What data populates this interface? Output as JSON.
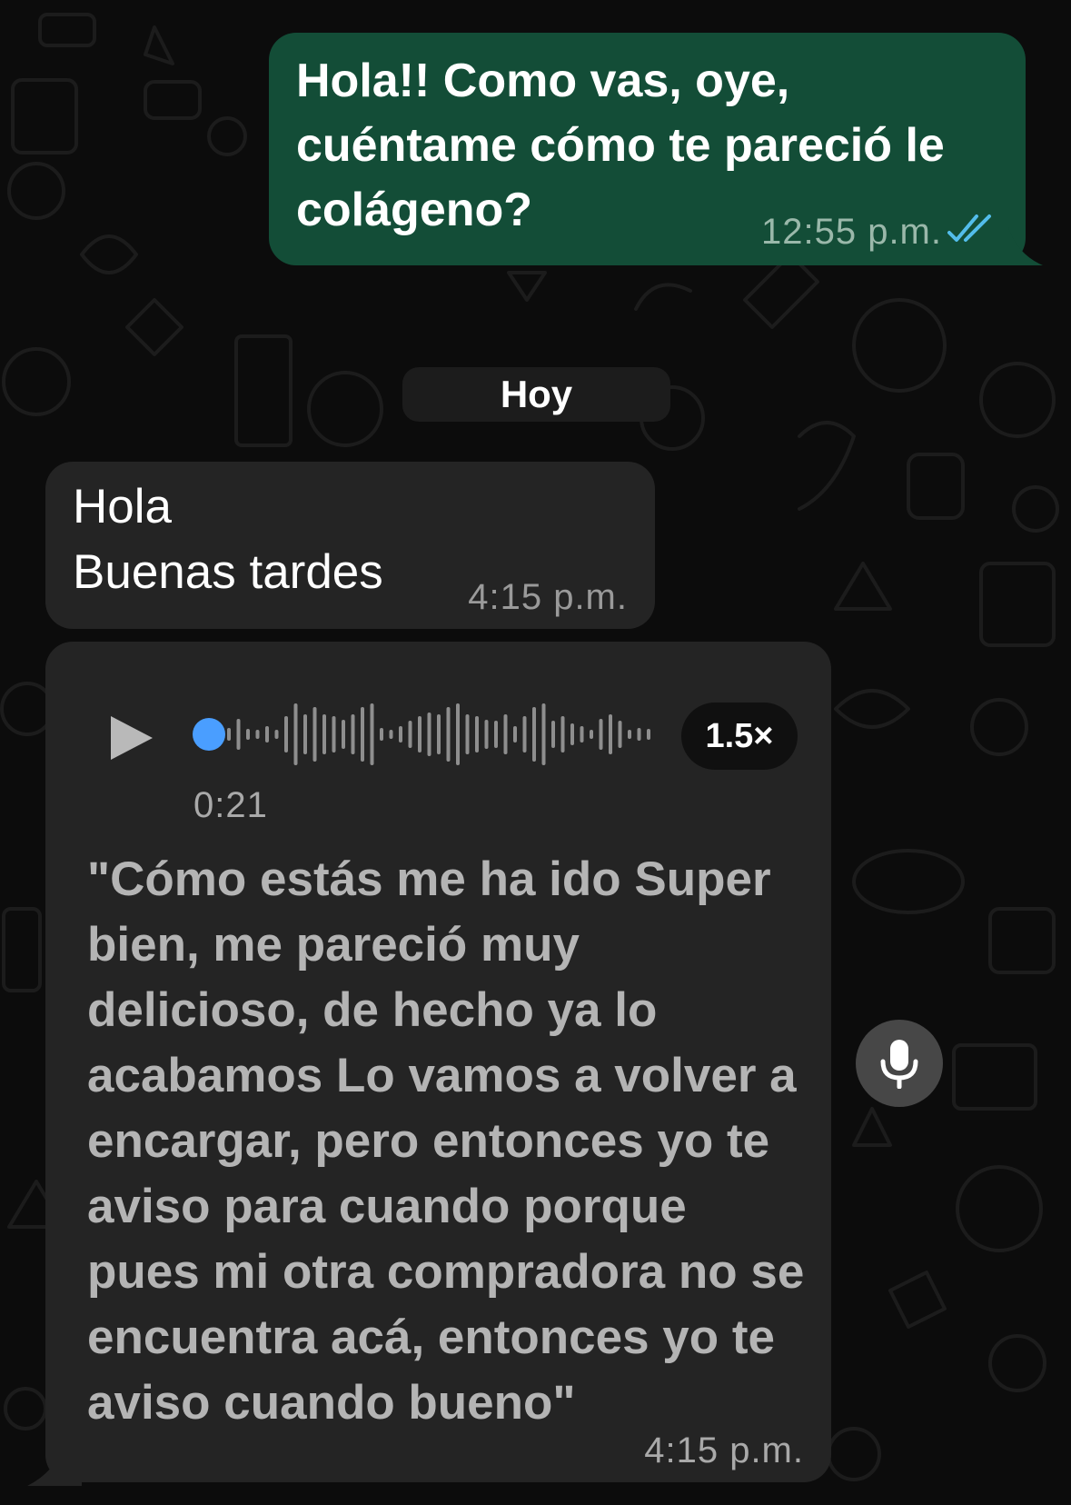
{
  "chat": {
    "outgoing_message": {
      "text": "Hola!! Como vas, oye,\ncuéntame cómo te pareció le\ncolágeno?",
      "time": "12:55 p.m.",
      "status_icon": "double-check-read-icon",
      "bubble_color": "#134d37",
      "tick_color": "#53bdeb"
    },
    "date_separator": "Hoy",
    "incoming_text_message": {
      "text": "Hola\nBuenas tardes",
      "time": "4:15 p.m.",
      "bubble_color": "#242424"
    },
    "voice_message": {
      "play_icon": "play-icon",
      "progress": 0,
      "progress_dot_color": "#4a9eff",
      "duration": "0:21",
      "speed": "1.5×",
      "transcript": "\"Cómo estás me ha ido Super bien, me pareció muy delicioso, de hecho ya lo acabamos Lo vamos a volver a encargar, pero entonces yo te aviso para cuando porque pues mi otra compradora no se encuentra acá, entonces yo te aviso cuando bueno\"",
      "time": "4:15 p.m."
    },
    "floating_mic": {
      "icon": "microphone-icon"
    }
  }
}
